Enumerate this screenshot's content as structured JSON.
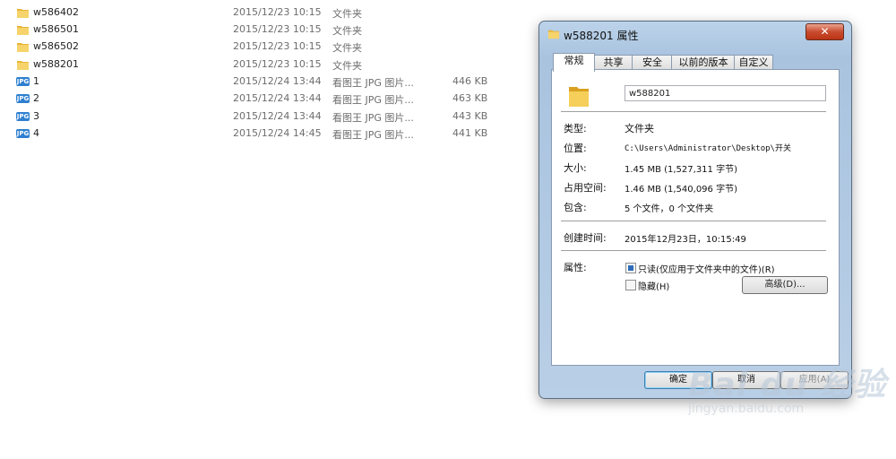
{
  "files": [
    {
      "name": "w586402",
      "date": "2015/12/23 10:15",
      "type": "文件夹",
      "size": "",
      "icon": "folder-icon"
    },
    {
      "name": "w586501",
      "date": "2015/12/23 10:15",
      "type": "文件夹",
      "size": "",
      "icon": "folder-icon"
    },
    {
      "name": "w586502",
      "date": "2015/12/23 10:15",
      "type": "文件夹",
      "size": "",
      "icon": "folder-icon"
    },
    {
      "name": "w588201",
      "date": "2015/12/23 10:15",
      "type": "文件夹",
      "size": "",
      "icon": "folder-icon"
    },
    {
      "name": "1",
      "date": "2015/12/24 13:44",
      "type": "看图王 JPG 图片...",
      "size": "446 KB",
      "icon": "jpg-file-icon"
    },
    {
      "name": "2",
      "date": "2015/12/24 13:44",
      "type": "看图王 JPG 图片...",
      "size": "463 KB",
      "icon": "jpg-file-icon"
    },
    {
      "name": "3",
      "date": "2015/12/24 13:44",
      "type": "看图王 JPG 图片...",
      "size": "443 KB",
      "icon": "jpg-file-icon"
    },
    {
      "name": "4",
      "date": "2015/12/24 14:45",
      "type": "看图王 JPG 图片...",
      "size": "441 KB",
      "icon": "jpg-file-icon"
    }
  ],
  "jpg_badge": "JPG",
  "dialog": {
    "title": "w588201 属性",
    "close_label": "✕",
    "tabs": [
      "常规",
      "共享",
      "安全",
      "以前的版本",
      "自定义"
    ],
    "name_value": "w588201",
    "props": {
      "type_label": "类型:",
      "type_value": "文件夹",
      "location_label": "位置:",
      "location_value": "C:\\Users\\Administrator\\Desktop\\开关",
      "size_label": "大小:",
      "size_value": "1.45 MB (1,527,311 字节)",
      "disk_label": "占用空间:",
      "disk_value": "1.46 MB (1,540,096 字节)",
      "contains_label": "包含:",
      "contains_value": "5 个文件，0 个文件夹",
      "created_label": "创建时间:",
      "created_value": "2015年12月23日，10:15:49",
      "attributes_label": "属性:"
    },
    "readonly_label": "只读(仅应用于文件夹中的文件)(R)",
    "hidden_label": "隐藏(H)",
    "advanced_label": "高级(D)...",
    "ok_label": "确定",
    "cancel_label": "取消",
    "apply_label": "应用(A)"
  },
  "watermark": {
    "brand": "Bai du 经验",
    "url": "jingyan.baidu.com"
  },
  "colors": {
    "accent": "#2e7fd0",
    "close": "#c94b2f",
    "dialog_frame": "#b9cfe6"
  }
}
